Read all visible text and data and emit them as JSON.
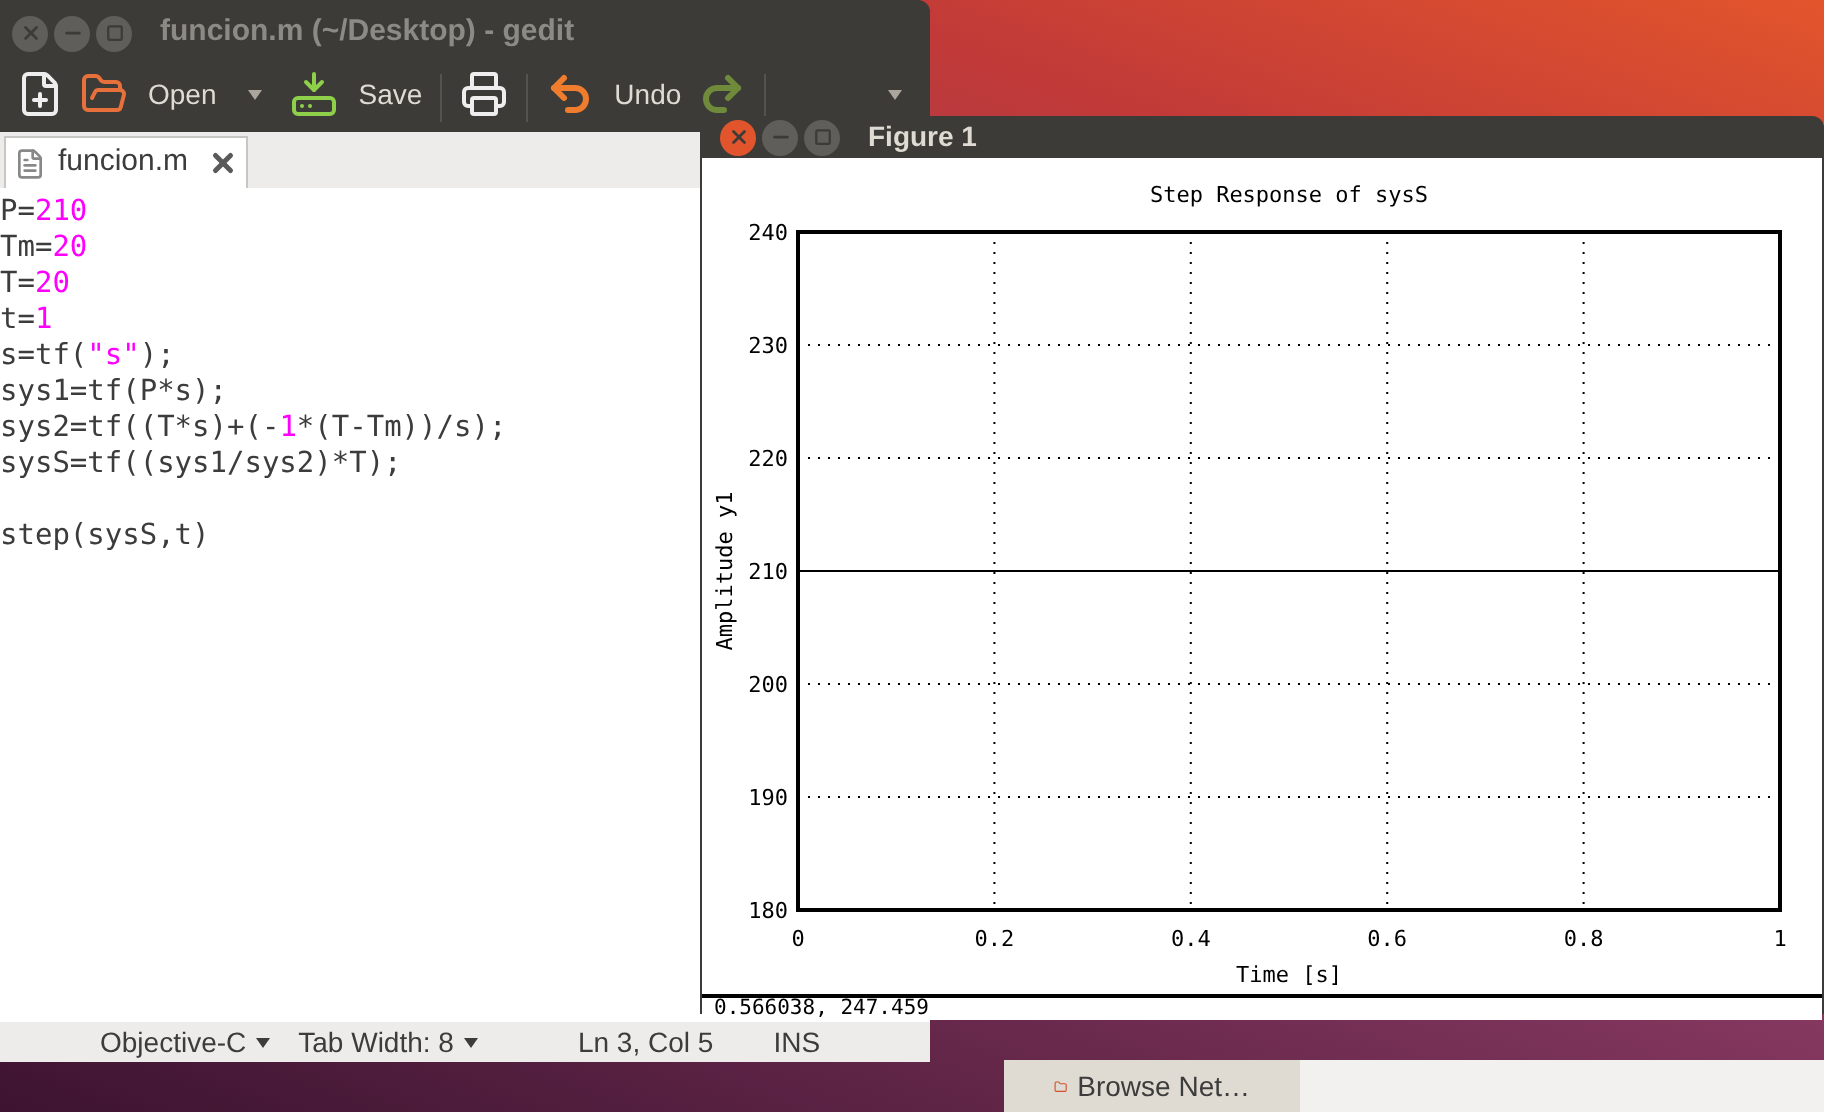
{
  "editor_window": {
    "title": "funcion.m (~/Desktop) - gedit",
    "toolbar": [
      {
        "kind": "new"
      },
      {
        "kind": "open",
        "label": "Open",
        "dropdown": true
      },
      {
        "kind": "save",
        "label": "Save"
      },
      {
        "kind": "print"
      },
      {
        "kind": "undo",
        "label": "Undo"
      },
      {
        "kind": "redo"
      },
      {
        "kind": "more",
        "dropdown": true
      }
    ],
    "tabs": [
      {
        "label": "funcion.m",
        "selected": true
      }
    ],
    "code_lines": [
      {
        "tokens": [
          {
            "text": "P=",
            "kind": "plain"
          },
          {
            "text": "210",
            "kind": "number"
          }
        ]
      },
      {
        "tokens": [
          {
            "text": "Tm=",
            "kind": "plain"
          },
          {
            "text": "20",
            "kind": "number"
          }
        ]
      },
      {
        "tokens": [
          {
            "text": "T=",
            "kind": "plain"
          },
          {
            "text": "20",
            "kind": "number"
          }
        ]
      },
      {
        "tokens": [
          {
            "text": "t=",
            "kind": "plain"
          },
          {
            "text": "1",
            "kind": "number"
          }
        ]
      },
      {
        "tokens": [
          {
            "text": "s=tf(",
            "kind": "plain"
          },
          {
            "text": "\"s\"",
            "kind": "string"
          },
          {
            "text": ");",
            "kind": "plain"
          }
        ]
      },
      {
        "tokens": [
          {
            "text": "sys1=tf(P*s);",
            "kind": "plain"
          }
        ]
      },
      {
        "tokens": [
          {
            "text": "sys2=tf((T*s)+(-",
            "kind": "plain"
          },
          {
            "text": "1",
            "kind": "number"
          },
          {
            "text": "*(T-Tm))/s);",
            "kind": "plain"
          }
        ]
      },
      {
        "tokens": [
          {
            "text": "sysS=tf((sys1/sys2)*T);",
            "kind": "plain"
          }
        ]
      },
      {
        "kind": "blank"
      },
      {
        "tokens": [
          {
            "text": "step(sysS,t)",
            "kind": "plain"
          }
        ]
      }
    ],
    "status_bar": [
      {
        "label": "Objective-C",
        "dropdown": true
      },
      {
        "label": "Tab Width: 8",
        "dropdown": true
      },
      {
        "label": "Ln 3, Col 5",
        "dropdown": false
      },
      {
        "label": "INS",
        "dropdown": false
      }
    ]
  },
  "figure_window": {
    "title": "Figure 1",
    "chart_data": {
      "type": "line",
      "title": "Step Response of sysS",
      "xlabel": "Time [s]",
      "ylabel": "Amplitude y1",
      "x": [
        0,
        1
      ],
      "values": [
        210,
        210
      ],
      "xlim": [
        0,
        1
      ],
      "ylim": [
        180,
        240
      ],
      "xticks": [
        {
          "value": 0,
          "label": "0"
        },
        {
          "value": 0.2,
          "label": "0.2"
        },
        {
          "value": 0.4,
          "label": "0.4"
        },
        {
          "value": 0.6,
          "label": "0.6"
        },
        {
          "value": 0.8,
          "label": "0.8"
        },
        {
          "value": 1,
          "label": "1"
        }
      ],
      "yticks": [
        180,
        190,
        200,
        210,
        220,
        230,
        240
      ],
      "grid": true
    },
    "pointer_readout": "0.566038, 247.459"
  },
  "taskbar": {
    "items": [
      {
        "label": "Browse Net…"
      }
    ]
  }
}
